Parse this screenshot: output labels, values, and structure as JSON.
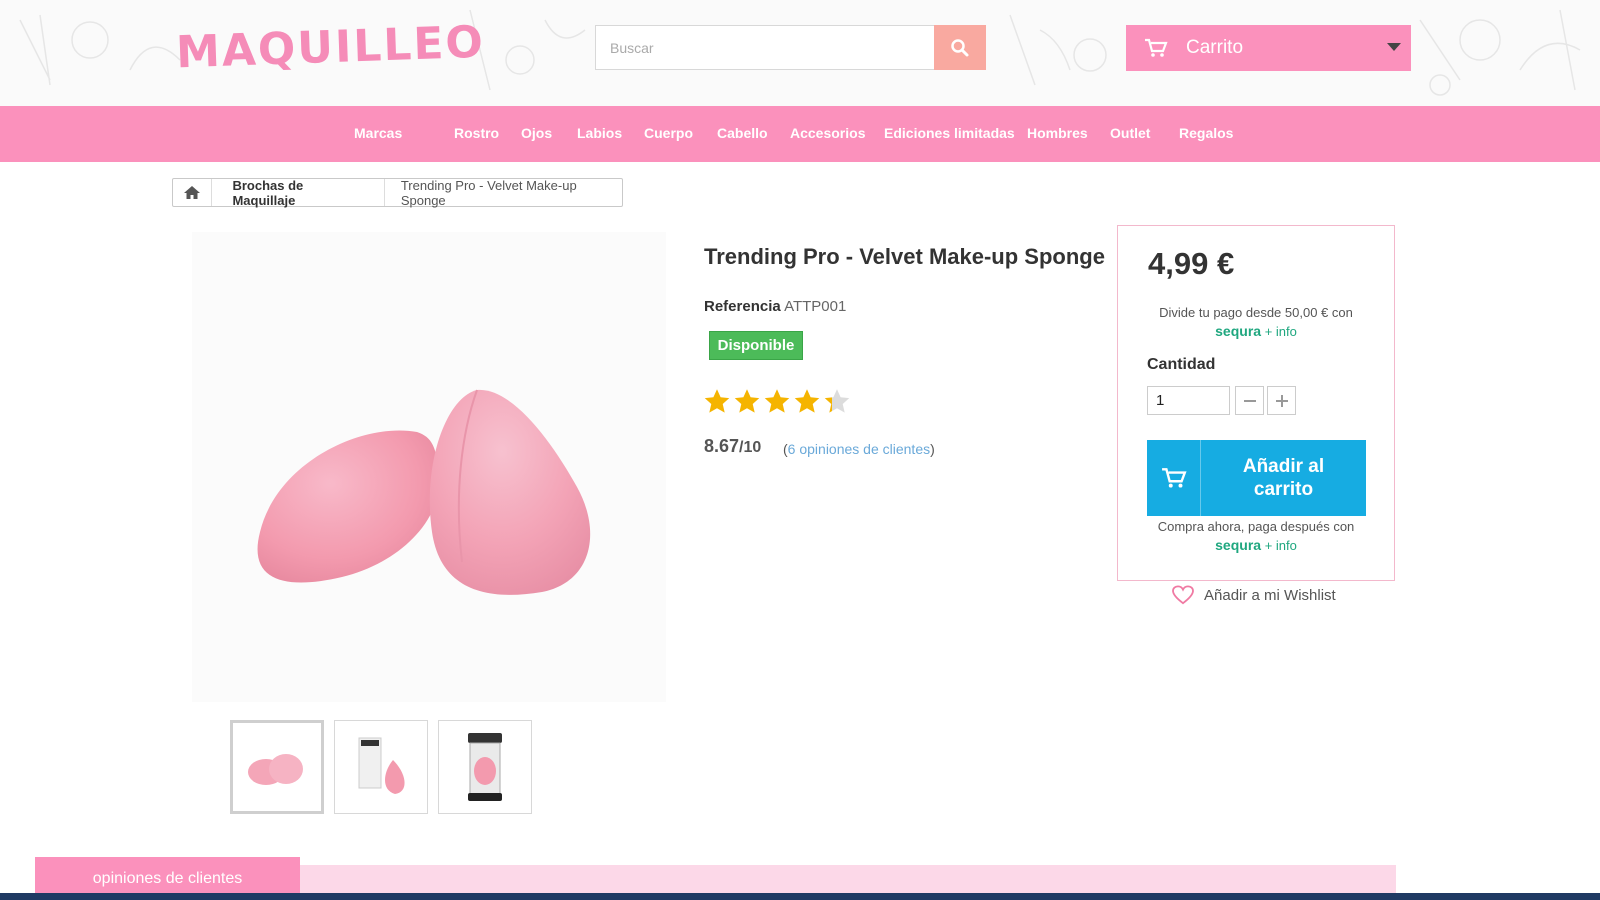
{
  "header": {
    "logo_text": "MAQUILLEO",
    "search_placeholder": "Buscar",
    "cart_label": "Carrito"
  },
  "nav": {
    "items": [
      "Marcas",
      "Rostro",
      "Ojos",
      "Labios",
      "Cuerpo",
      "Cabello",
      "Accesorios",
      "Ediciones limitadas",
      "Hombres",
      "Outlet",
      "Regalos"
    ]
  },
  "breadcrumb": {
    "items": [
      "Brochas de Maquillaje",
      "Trending Pro - Velvet Make-up Sponge"
    ]
  },
  "product": {
    "title": "Trending Pro - Velvet Make-up Sponge",
    "reference_label": "Referencia",
    "reference_value": "ATTP001",
    "availability": "Disponible",
    "rating_stars": 4.3,
    "rating_score": "8.67",
    "rating_scale": "/10",
    "reviews_open": "(",
    "reviews_link": "6 opiniones de clientes",
    "reviews_close": ")"
  },
  "buybox": {
    "price": "4,99 €",
    "sequra_top_text": "Divide tu pago desde 50,00 € con",
    "sequra_brand": "sequra",
    "sequra_info": "+ info",
    "quantity_label": "Cantidad",
    "quantity_value": "1",
    "add_to_cart_label": "Añadir al carrito",
    "sequra_bottom_text": "Compra ahora, paga después con",
    "wishlist_label": "Añadir a mi Wishlist"
  },
  "bottom": {
    "reviews_tab_label": "opiniones de clientes"
  },
  "colors": {
    "pink": "#fb91bc",
    "search_button": "#f9a9a0",
    "add_to_cart": "#16ace2",
    "available": "#4cbb59",
    "star": "#f5b400",
    "sequra": "#1fa77f"
  },
  "icons": [
    "search-icon",
    "cart-icon",
    "home-icon",
    "star-icon",
    "minus-icon",
    "plus-icon",
    "heart-icon"
  ]
}
